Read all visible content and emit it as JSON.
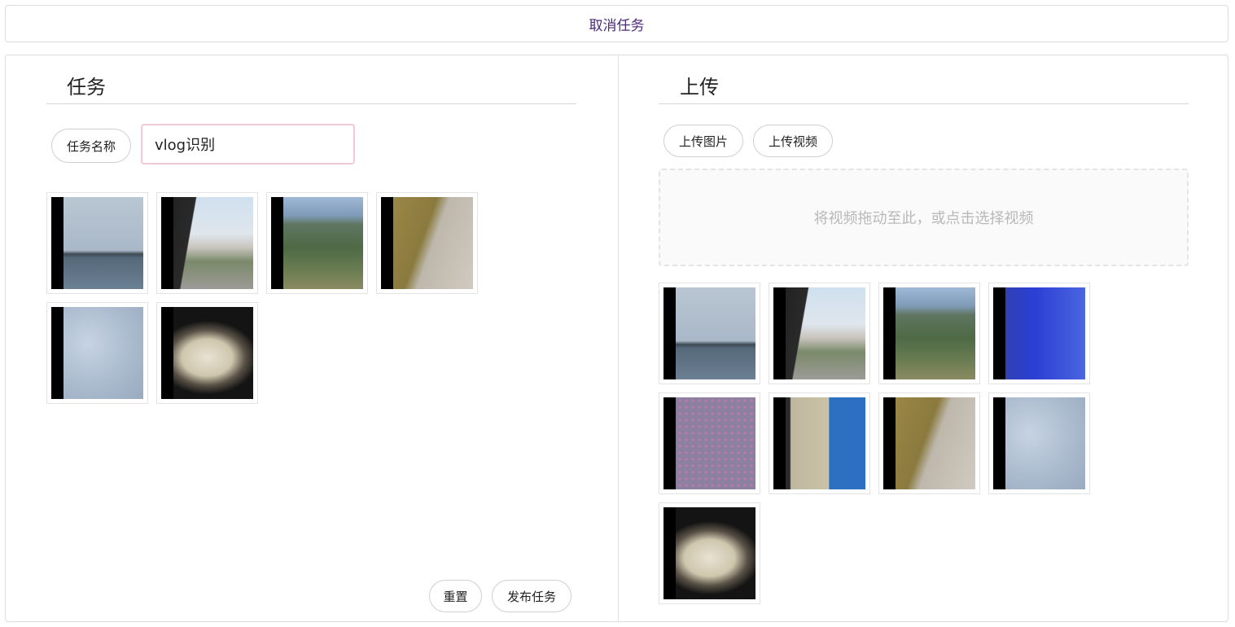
{
  "top_bar": {
    "cancel_label": "取消任务"
  },
  "task_panel": {
    "title": "任务",
    "name_label": "任务名称",
    "name_value": "vlog识别",
    "reset_label": "重置",
    "publish_label": "发布任务",
    "thumbnails": [
      {
        "scene": "lake"
      },
      {
        "scene": "house-car"
      },
      {
        "scene": "forest"
      },
      {
        "scene": "path-walker"
      },
      {
        "scene": "water-texture"
      },
      {
        "scene": "food-bowl"
      }
    ]
  },
  "upload_panel": {
    "title": "上传",
    "upload_image_label": "上传图片",
    "upload_video_label": "上传视频",
    "dropzone_text": "将视频拖动至此，或点击选择视频",
    "thumbnails": [
      {
        "scene": "lake"
      },
      {
        "scene": "house-car"
      },
      {
        "scene": "forest"
      },
      {
        "scene": "screen-person"
      },
      {
        "scene": "dot-pattern"
      },
      {
        "scene": "shop-person"
      },
      {
        "scene": "path-walker"
      },
      {
        "scene": "water-texture"
      },
      {
        "scene": "food-bowl"
      }
    ]
  }
}
